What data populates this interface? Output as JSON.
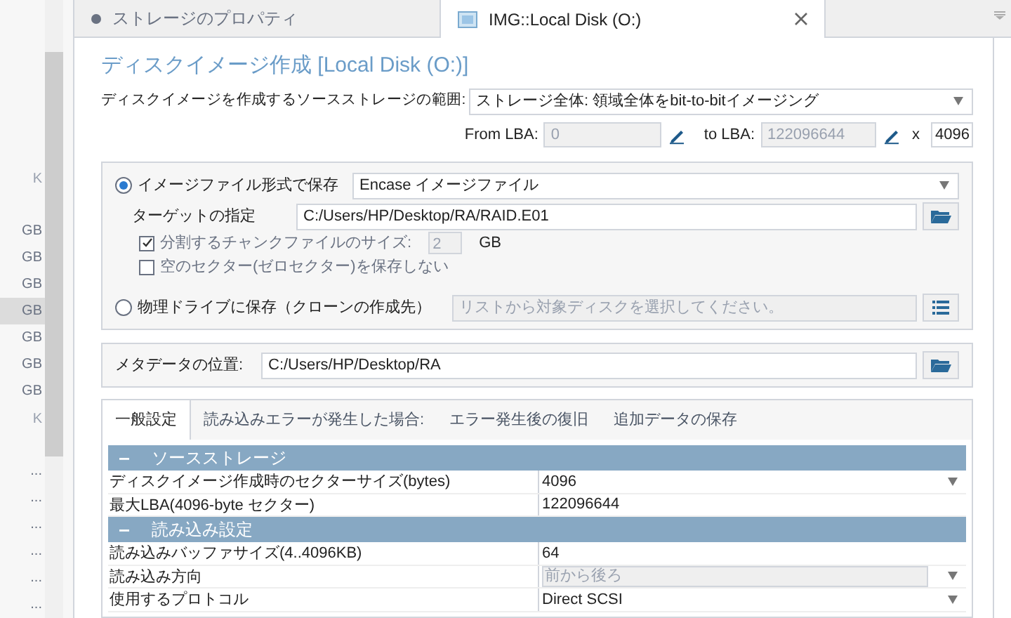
{
  "sidebar": {
    "items": [
      {
        "text": "K",
        "kind": "header",
        "selected": false
      },
      {
        "text": "GB",
        "kind": "size",
        "selected": false
      },
      {
        "text": "GB",
        "kind": "size",
        "selected": false
      },
      {
        "text": "GB",
        "kind": "size",
        "selected": false
      },
      {
        "text": "GB",
        "kind": "size",
        "selected": true
      },
      {
        "text": "GB",
        "kind": "size",
        "selected": false
      },
      {
        "text": "GB",
        "kind": "size",
        "selected": false
      },
      {
        "text": "GB",
        "kind": "size",
        "selected": false
      },
      {
        "text": "K",
        "kind": "header",
        "selected": false
      },
      {
        "text": "...",
        "kind": "size",
        "selected": false
      },
      {
        "text": "...",
        "kind": "size",
        "selected": false
      },
      {
        "text": "...",
        "kind": "size",
        "selected": false
      },
      {
        "text": "...",
        "kind": "size",
        "selected": false
      },
      {
        "text": "...",
        "kind": "size",
        "selected": false
      },
      {
        "text": "...",
        "kind": "size",
        "selected": false
      }
    ]
  },
  "tabs": [
    {
      "label": "ストレージのプロパティ",
      "selected": false
    },
    {
      "label": "IMG::Local Disk (O:)",
      "selected": true
    }
  ],
  "title": "ディスクイメージ作成 [Local Disk (O:)]",
  "range": {
    "label": "ディスクイメージを作成するソースストレージの範囲:",
    "value": "ストレージ全体: 領域全体をbit-to-bitイメージング",
    "from_label": "From LBA:",
    "from_value": "0",
    "to_label": "to LBA:",
    "to_value": "122096644",
    "times": "x",
    "sector": "4096"
  },
  "image_option": {
    "label": "イメージファイル形式で保存",
    "selected": true,
    "format": "Encase イメージファイル",
    "target_label": "ターゲットの指定",
    "target_value": "C:/Users/HP/Desktop/RA/RAID.E01",
    "chunk_label": "分割するチャンクファイルのサイズ:",
    "chunk_checked": true,
    "chunk_value": "2",
    "chunk_unit": "GB",
    "zero_label": "空のセクター(ゼロセクター)を保存しない",
    "zero_checked": false
  },
  "clone_option": {
    "label": "物理ドライブに保存（クローンの作成先）",
    "selected": false,
    "placeholder": "リストから対象ディスクを選択してください。"
  },
  "metadata": {
    "label": "メタデータの位置:",
    "value": "C:/Users/HP/Desktop/RA"
  },
  "settings_tabs": [
    {
      "label": "一般設定",
      "selected": true
    },
    {
      "label": "読み込みエラーが発生した場合:",
      "selected": false
    },
    {
      "label": "エラー発生後の復旧",
      "selected": false
    },
    {
      "label": "追加データの保存",
      "selected": false
    }
  ],
  "sections": [
    {
      "title": "ソースストレージ",
      "expanded": true,
      "rows": [
        {
          "name": "ディスクイメージ作成時のセクターサイズ(bytes)",
          "value": "4096",
          "kind": "dropdown"
        },
        {
          "name": "最大LBA(4096-byte セクター)",
          "value": "122096644",
          "kind": "text"
        }
      ]
    },
    {
      "title": "読み込み設定",
      "expanded": true,
      "rows": [
        {
          "name": "読み込みバッファサイズ(4..4096KB)",
          "value": "64",
          "kind": "text"
        },
        {
          "name": "読み込み方向",
          "value": "前から後ろ",
          "kind": "disabled"
        },
        {
          "name": "使用するプロトコル",
          "value": "Direct SCSI",
          "kind": "dropdown"
        }
      ]
    }
  ]
}
